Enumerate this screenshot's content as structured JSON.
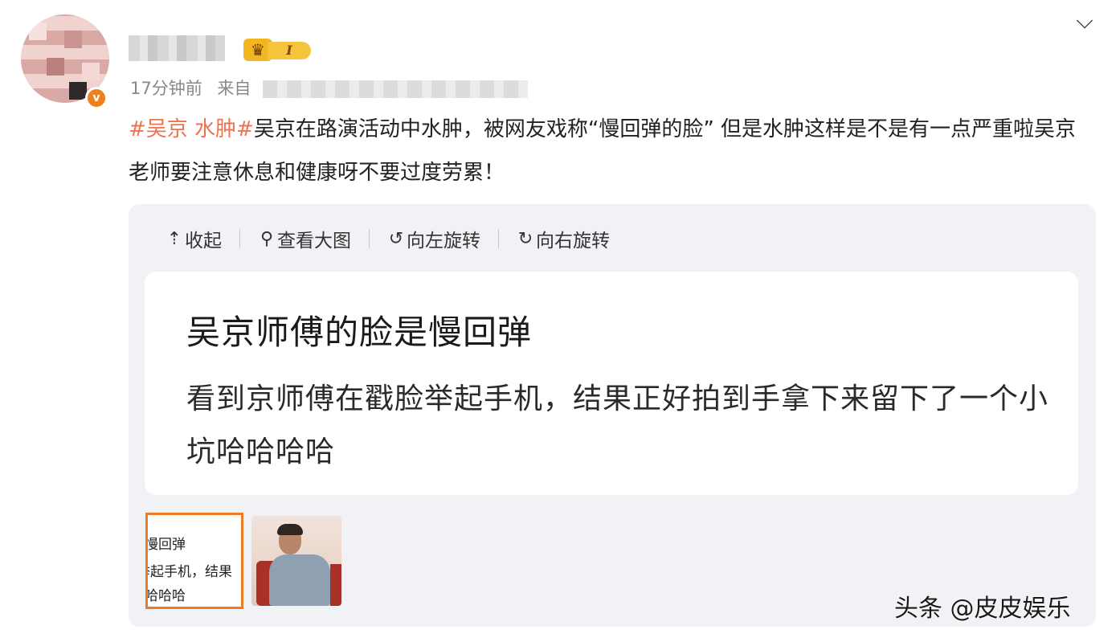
{
  "post": {
    "time": "17分钟前",
    "source_prefix": "来自",
    "vip_level": "I",
    "hashtag": "#吴京 水肿#",
    "text": "吴京在路演活动中水肿，被网友戏称“慢回弹的脸” 但是水肿这样是不是有一点严重啦吴京老师要注意休息和健康呀不要过度劳累！",
    "icons": {
      "menu": "chevron-down-icon",
      "verified": "verified-badge-icon",
      "vip": "crown-icon"
    }
  },
  "toolbar": {
    "collapse": "收起",
    "view_large": "查看大图",
    "rotate_left": "向左旋转",
    "rotate_right": "向右旋转"
  },
  "image": {
    "title": "吴京师傅的脸是慢回弹",
    "body": "看到京师傅在戳脸举起手机，结果正好拍到手拿下来留下了一个小坑哈哈哈哈"
  },
  "thumbnails": {
    "thumb1_lines": [
      "慢回弹",
      "举起手机，结果",
      "哈哈哈"
    ]
  },
  "watermark": "头条 @皮皮娱乐",
  "colors": {
    "hashtag": "#eb7350",
    "selected_thumb_border": "#f07b25",
    "card_bg": "#f1f2f5"
  }
}
